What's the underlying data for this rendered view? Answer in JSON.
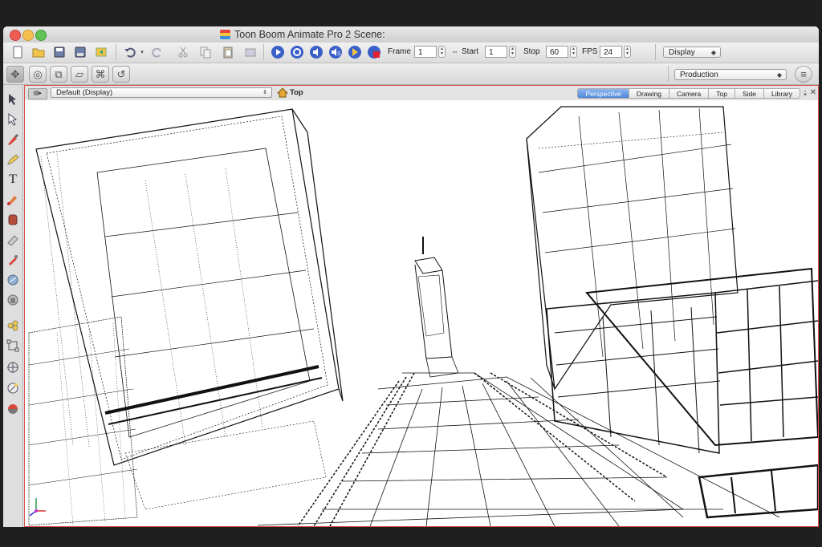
{
  "window": {
    "title": "Toon Boom Animate Pro 2 Scene:"
  },
  "toolbar": {
    "buttons": [
      "new-scene-icon",
      "open-scene-icon",
      "save-icon",
      "save-as-icon",
      "export-icon",
      "undo-icon",
      "dropdown-arrow-icon",
      "redo-icon",
      "cut-icon",
      "copy-icon",
      "paste-icon",
      "delete-icon",
      "play-icon",
      "loop-icon",
      "sound-icon",
      "sound-scrub-icon",
      "render-icon",
      "stop-render-icon"
    ],
    "frame_label": "Frame",
    "frame_value": "1",
    "start_label": "Start",
    "start_value": "1",
    "stop_label": "Stop",
    "stop_value": "60",
    "fps_label": "FPS",
    "fps_value": "24",
    "display_dropdown": "Display",
    "production_dropdown": "Production"
  },
  "view": {
    "display_selector": "Default (Display)",
    "camera_label": "Top",
    "tabs": [
      {
        "label": "Perspective",
        "active": true
      },
      {
        "label": "Drawing",
        "active": false
      },
      {
        "label": "Camera",
        "active": false
      },
      {
        "label": "Top",
        "active": false
      },
      {
        "label": "Side",
        "active": false
      },
      {
        "label": "Library",
        "active": false
      }
    ]
  },
  "tools": [
    "select-icon",
    "contour-editor-icon",
    "brush-icon",
    "pencil-icon",
    "text-icon",
    "paint-icon",
    "ink-icon",
    "eraser-icon",
    "dropper-icon",
    "stroke-icon",
    "hand-icon",
    "transform-icon",
    "morph-icon",
    "zoom-icon",
    "pivot-icon",
    "color-swatch-icon"
  ],
  "colors": {
    "active_tab": "#4d86d8",
    "panel_border": "#d9534f",
    "wireframe": "#111111"
  }
}
